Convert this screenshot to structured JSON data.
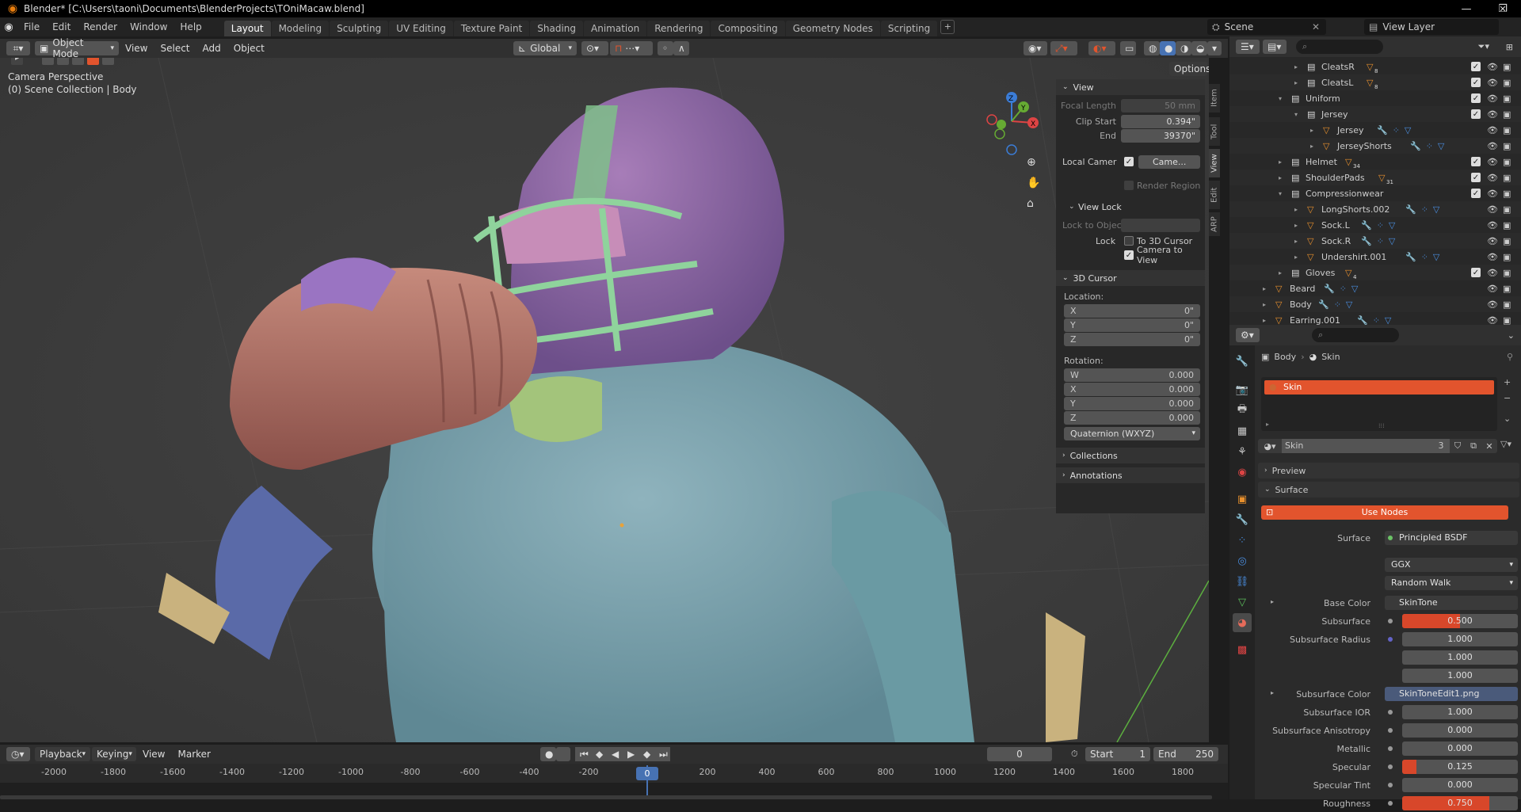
{
  "window": {
    "title": "Blender* [C:\\Users\\taoni\\Documents\\BlenderProjects\\TOniMacaw.blend]"
  },
  "menus": [
    "File",
    "Edit",
    "Render",
    "Window",
    "Help"
  ],
  "workspaces": [
    "Layout",
    "Modeling",
    "Sculpting",
    "UV Editing",
    "Texture Paint",
    "Shading",
    "Animation",
    "Rendering",
    "Compositing",
    "Geometry Nodes",
    "Scripting"
  ],
  "scene": {
    "name": "Scene",
    "view_layer": "View Layer"
  },
  "viewport_header": {
    "mode": "Object Mode",
    "view": "View",
    "select": "Select",
    "add": "Add",
    "object": "Object",
    "transform": "Global",
    "options": "Options"
  },
  "viewport": {
    "camera": "Camera Perspective",
    "collection": "(0) Scene Collection | Body"
  },
  "npanel": {
    "view_header": "View",
    "focal_length_label": "Focal Length",
    "focal_length": "50 mm",
    "clip_start_label": "Clip Start",
    "clip_start": "0.394\"",
    "end_label": "End",
    "clip_end": "39370\"",
    "local_camera_label": "Local Camer",
    "local_camera_value": "Came...",
    "render_region": "Render Region",
    "view_lock_header": "View Lock",
    "lock_to_object": "Lock to Objec",
    "lock_label": "Lock",
    "to_3d_cursor": "To 3D Cursor",
    "camera_to_view": "Camera to View",
    "cursor_header": "3D Cursor",
    "location_label": "Location:",
    "loc": [
      {
        "axis": "X",
        "value": "0\""
      },
      {
        "axis": "Y",
        "value": "0\""
      },
      {
        "axis": "Z",
        "value": "0\""
      }
    ],
    "rotation_label": "Rotation:",
    "rot": [
      {
        "axis": "W",
        "value": "0.000"
      },
      {
        "axis": "X",
        "value": "0.000"
      },
      {
        "axis": "Y",
        "value": "0.000"
      },
      {
        "axis": "Z",
        "value": "0.000"
      }
    ],
    "rotation_mode": "Quaternion (WXYZ)",
    "collections": "Collections",
    "annotations": "Annotations"
  },
  "side_tabs": [
    "Item",
    "Tool",
    "View",
    "Edit",
    "ARP"
  ],
  "outliner": {
    "rows": [
      {
        "name": "CleatsR",
        "badge": "8",
        "indent": 4,
        "kind": "collection"
      },
      {
        "name": "CleatsL",
        "badge": "8",
        "indent": 4,
        "kind": "collection"
      },
      {
        "name": "Uniform",
        "badge": "",
        "indent": 3,
        "kind": "collection"
      },
      {
        "name": "Jersey",
        "badge": "",
        "indent": 4,
        "kind": "collection"
      },
      {
        "name": "Jersey",
        "badge": "",
        "indent": 5,
        "kind": "mesh"
      },
      {
        "name": "JerseyShorts",
        "badge": "",
        "indent": 5,
        "kind": "mesh"
      },
      {
        "name": "Helmet",
        "badge": "34",
        "indent": 3,
        "kind": "collection"
      },
      {
        "name": "ShoulderPads",
        "badge": "31",
        "indent": 3,
        "kind": "collection"
      },
      {
        "name": "Compressionwear",
        "badge": "",
        "indent": 3,
        "kind": "collection"
      },
      {
        "name": "LongShorts.002",
        "badge": "",
        "indent": 4,
        "kind": "mesh"
      },
      {
        "name": "Sock.L",
        "badge": "",
        "indent": 4,
        "kind": "mesh"
      },
      {
        "name": "Sock.R",
        "badge": "",
        "indent": 4,
        "kind": "mesh"
      },
      {
        "name": "Undershirt.001",
        "badge": "",
        "indent": 4,
        "kind": "mesh"
      },
      {
        "name": "Gloves",
        "badge": "4",
        "indent": 3,
        "kind": "collection"
      },
      {
        "name": "Beard",
        "badge": "",
        "indent": 2,
        "kind": "mesh"
      },
      {
        "name": "Body",
        "badge": "",
        "indent": 2,
        "kind": "mesh"
      },
      {
        "name": "Earring.001",
        "badge": "",
        "indent": 2,
        "kind": "mesh"
      }
    ]
  },
  "properties": {
    "breadcrumb_object": "Body",
    "breadcrumb_material": "Skin",
    "slot_name": "Skin",
    "material_name": "Skin",
    "users": "3",
    "preview": "Preview",
    "surface_header": "Surface",
    "use_nodes": "Use Nodes",
    "surface_label": "Surface",
    "surface_value": "Principled BSDF",
    "distribution": "GGX",
    "subsurface_method": "Random Walk",
    "rows": [
      {
        "label": "Base Color",
        "value": "SkinTone",
        "kind": "link"
      },
      {
        "label": "Subsurface",
        "value": "0.500",
        "kind": "slider",
        "fill": 0.5
      },
      {
        "label": "Subsurface Radius",
        "value": "1.000",
        "kind": "vec"
      },
      {
        "label": "",
        "value": "1.000",
        "kind": "vec"
      },
      {
        "label": "",
        "value": "1.000",
        "kind": "vec"
      },
      {
        "label": "Subsurface Color",
        "value": "SkinToneEdit1.png",
        "kind": "link"
      },
      {
        "label": "Subsurface IOR",
        "value": "1.000",
        "kind": "num"
      },
      {
        "label": "Subsurface Anisotropy",
        "value": "0.000",
        "kind": "num"
      },
      {
        "label": "Metallic",
        "value": "0.000",
        "kind": "num"
      },
      {
        "label": "Specular",
        "value": "0.125",
        "kind": "slider",
        "fill": 0.125
      },
      {
        "label": "Specular Tint",
        "value": "0.000",
        "kind": "num"
      },
      {
        "label": "Roughness",
        "value": "0.750",
        "kind": "slider",
        "fill": 0.75
      }
    ]
  },
  "timeline": {
    "playback": "Playback",
    "keying": "Keying",
    "view": "View",
    "marker": "Marker",
    "current_frame": "0",
    "start_label": "Start",
    "start": "1",
    "end_label": "End",
    "end": "250",
    "ticks": [
      "-2000",
      "-1800",
      "-1600",
      "-1400",
      "-1200",
      "-1000",
      "-800",
      "-600",
      "-400",
      "-200",
      "0",
      "200",
      "400",
      "600",
      "800",
      "1000",
      "1200",
      "1400",
      "1600",
      "1800"
    ],
    "playhead": "0"
  },
  "colors": {
    "accent": "#e2542d",
    "active_blue": "#4772b3",
    "slider_red": "#d8472a"
  }
}
